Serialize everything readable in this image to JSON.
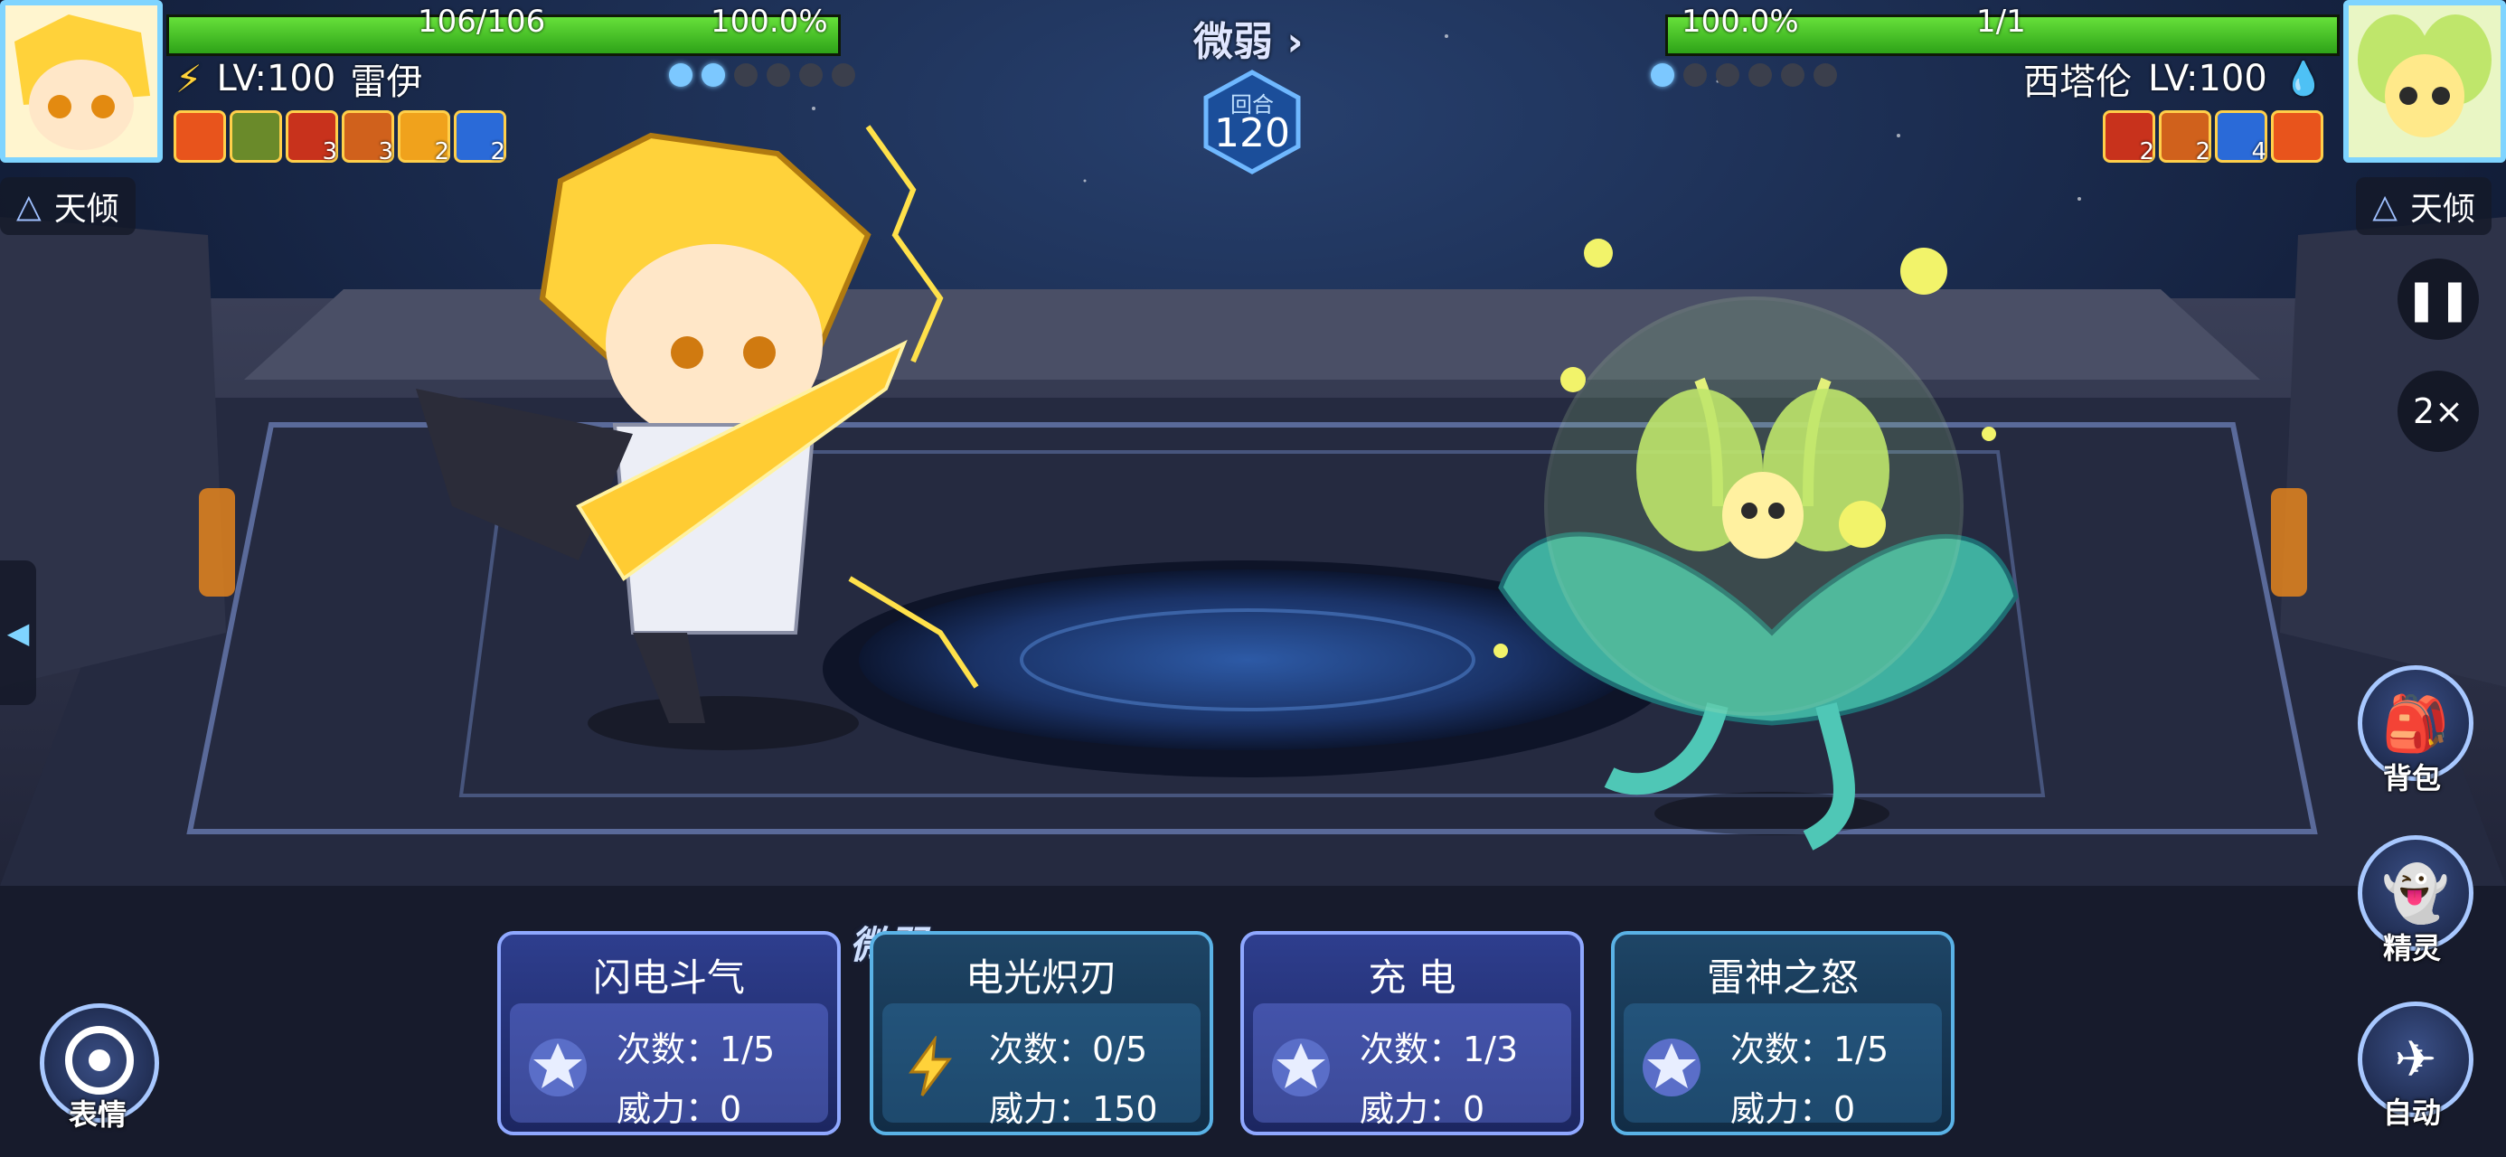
{
  "player": {
    "hp": "106/106",
    "hp_percent": "100.0%",
    "hp_fraction": 1.0,
    "level": "LV:100",
    "name": "雷伊",
    "energy_on": 2,
    "energy_total": 6,
    "buffs": [
      {
        "icon": "fire-buff-icon",
        "count": ""
      },
      {
        "icon": "skull-buff-icon",
        "count": ""
      },
      {
        "icon": "attack-up-icon",
        "count": "3"
      },
      {
        "icon": "defense-up-icon",
        "count": "3"
      },
      {
        "icon": "arrow-up-icon",
        "count": "2"
      },
      {
        "icon": "speed-up-icon",
        "count": "2"
      }
    ],
    "tag": "天倾"
  },
  "enemy": {
    "hp": "1/1",
    "hp_percent": "100.0%",
    "hp_fraction": 1.0,
    "name": "西塔伦",
    "level": "LV:100",
    "energy_on": 1,
    "energy_total": 6,
    "buffs": [
      {
        "icon": "attack-up-icon",
        "count": "2"
      },
      {
        "icon": "defense-up-icon",
        "count": "2"
      },
      {
        "icon": "speed-up-icon",
        "count": "4"
      },
      {
        "icon": "fire-buff-icon",
        "count": ""
      }
    ],
    "tag": "天倾"
  },
  "center": {
    "status": "微弱",
    "round_label": "回合",
    "round_number": "120"
  },
  "controls": {
    "speed_label": "2×",
    "backpack": "背包",
    "spirit": "精灵",
    "auto": "自动",
    "emote": "表情"
  },
  "skills": [
    {
      "name": "闪电斗气",
      "uses": "次数：1/5",
      "power": "威力：0",
      "type": "star"
    },
    {
      "name": "电光炽刃",
      "uses": "次数：0/5",
      "power": "威力：150",
      "type": "electric"
    },
    {
      "name": "充  电",
      "uses": "次数：1/3",
      "power": "威力：0",
      "type": "star"
    },
    {
      "name": "雷神之怒",
      "uses": "次数：1/5",
      "power": "威力：0",
      "type": "star"
    }
  ],
  "skill_weak_tag": "微弱",
  "colors": {
    "hp_green": "#3fc21f",
    "accent_blue": "#7fd4ff",
    "card_blue": "#2e3e8e"
  }
}
